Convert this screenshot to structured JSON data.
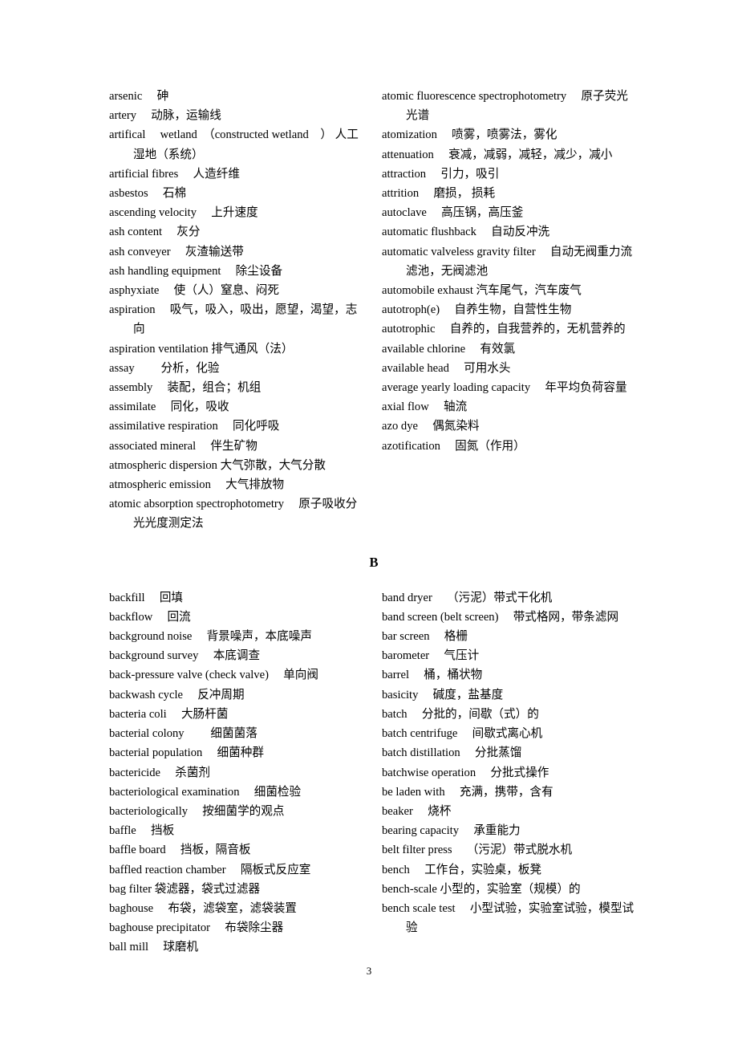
{
  "document": {
    "type": "bilingual-glossary",
    "page_number": "3",
    "section_letter": "B"
  },
  "section_a": {
    "left_column": [
      "arsenic　 砷",
      "artery　 动脉，运输线",
      "artifical　 wetland　（constructed wetland　） 人工湿地（系统）",
      "artificial fibres　 人造纤维",
      "asbestos　 石棉",
      "ascending velocity　 上升速度",
      "ash content　 灰分",
      "ash conveyer　 灰渣输送带",
      "ash handling equipment　 除尘设备",
      "asphyxiate　 使（人）窒息、闷死",
      "aspiration　 吸气，吸入，吸出，愿望，渴望，志向",
      "aspiration ventilation 排气通风（法）",
      "assay　　 分析，化验",
      "assembly　 装配，组合；机组",
      "assimilate　 同化，吸收",
      "assimilative respiration　 同化呼吸",
      "associated mineral　 伴生矿物",
      "atmospheric dispersion 大气弥散，大气分散",
      "atmospheric emission　 大气排放物",
      "atomic absorption spectrophotometry　 原子吸收分光光度测定法"
    ],
    "right_column": [
      "atomic fluorescence spectrophotometry　 原子荧光光谱",
      "atomization　 喷雾，喷雾法，雾化",
      "attenuation　 衰减，减弱，减轻，减少，减小",
      "attraction　 引力，吸引",
      "attrition　 磨损， 损耗",
      "autoclave　 高压锅，高压釜",
      "automatic flushback　 自动反冲洗",
      "automatic valveless gravity filter　 自动无阀重力流滤池，无阀滤池",
      "automobile exhaust 汽车尾气，汽车废气",
      "autotroph(e)　 自养生物，自营性生物",
      "autotrophic　 自养的，自我营养的，无机营养的",
      "available chlorine　 有效氯",
      "available head　 可用水头",
      "average yearly loading capacity　 年平均负荷容量",
      "axial flow　 轴流",
      "azo dye　 偶氮染料",
      "azotification　 固氮（作用）"
    ]
  },
  "section_b": {
    "left_column": [
      "backfill　 回填",
      "backflow　 回流",
      "background noise　 背景噪声，本底噪声",
      "background survey　 本底调查",
      "back-pressure valve (check valve)　 单向阀",
      "backwash cycle　 反冲周期",
      "bacteria coli　 大肠杆菌",
      "bacterial colony　　 细菌菌落",
      "bacterial population　 细菌种群",
      "bactericide　 杀菌剂",
      "bacteriological examination　 细菌检验",
      "bacteriologically　 按细菌学的观点",
      "baffle　 挡板",
      "baffle board　 挡板，隔音板",
      "baffled reaction chamber　 隔板式反应室",
      "bag filter 袋滤器，袋式过滤器",
      "baghouse　 布袋，滤袋室，滤袋装置",
      "baghouse precipitator　 布袋除尘器",
      "ball mill　 球磨机"
    ],
    "right_column": [
      "band dryer　 （污泥）带式干化机",
      "band screen (belt screen)　 带式格网，带条滤网",
      "bar screen　 格栅",
      "barometer　 气压计",
      "barrel　 桶，桶状物",
      "basicity　 碱度，盐基度",
      "batch　 分批的，间歇（式）的",
      "batch centrifuge　 间歇式离心机",
      "batch distillation　 分批蒸馏",
      "batchwise operation　 分批式操作",
      "be laden with　 充满，携带，含有",
      "beaker　 烧杯",
      "bearing capacity　 承重能力",
      "belt filter press　 （污泥）带式脱水机",
      "bench　 工作台，实验桌，板凳",
      "bench-scale 小型的，实验室（规模）的",
      "bench scale test　 小型试验，实验室试验，模型试验"
    ]
  }
}
